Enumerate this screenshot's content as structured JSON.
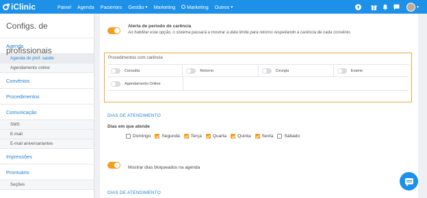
{
  "brand": {
    "name": "iClinic"
  },
  "nav": {
    "items": [
      {
        "label": "Painel"
      },
      {
        "label": "Agenda"
      },
      {
        "label": "Pacientes"
      },
      {
        "label": "Gestão",
        "dropdown": true
      },
      {
        "label": "Marketing"
      },
      {
        "label": "Marketing",
        "icon": "marketing-icon"
      },
      {
        "label": "Outros",
        "dropdown": true
      }
    ],
    "icons": [
      "add-circle-icon",
      "gift-icon",
      "bell-icon",
      "chat-icon",
      "avatar"
    ]
  },
  "sidebar": {
    "title": "Configs. de profissionais",
    "sections": [
      {
        "label": "Agenda",
        "items": [
          {
            "label": "Agenda do prof. saúde",
            "active": true
          },
          {
            "label": "Agendamento online"
          }
        ]
      },
      {
        "label": "Convênios",
        "items": []
      },
      {
        "label": "Procedimentos",
        "items": []
      },
      {
        "label": "Comunicação",
        "items": [
          {
            "label": "SMS"
          },
          {
            "label": "E-mail"
          },
          {
            "label": "E-mail aniversariantes"
          }
        ]
      },
      {
        "label": "Impressões",
        "items": []
      },
      {
        "label": "Prontuário",
        "items": [
          {
            "label": "Seções"
          }
        ]
      }
    ]
  },
  "main": {
    "alert": {
      "title": "Alerta de período de carência",
      "description": "Ao habilitar esta opção, o sistema passará a mostrar a data limite para retorno respeitando a carência de cada convênio.",
      "enabled": true
    },
    "procedures": {
      "title": "Procedimentos com carência",
      "items": [
        {
          "label": "Consulta",
          "enabled": false
        },
        {
          "label": "Retorno",
          "enabled": false
        },
        {
          "label": "Cirurgia",
          "enabled": false
        },
        {
          "label": "Exame",
          "enabled": false
        },
        {
          "label": "Agendamento Online",
          "enabled": false
        }
      ]
    },
    "days_heading": "DIAS DE ATENDIMENTO",
    "days_label": "Dias em que atende",
    "days": [
      {
        "label": "Domingo",
        "checked": false
      },
      {
        "label": "Segunda",
        "checked": true
      },
      {
        "label": "Terça",
        "checked": true
      },
      {
        "label": "Quarta",
        "checked": true
      },
      {
        "label": "Quinta",
        "checked": true
      },
      {
        "label": "Sexta",
        "checked": true
      },
      {
        "label": "Sábado",
        "checked": false
      }
    ],
    "blocked_days": {
      "label": "Mostrar dias bloqueados na agenda",
      "enabled": true
    },
    "days_heading_2": "DIAS DE ATENDIMENTO"
  },
  "colors": {
    "primary": "#1d90e8",
    "accent": "#f59d1f",
    "link": "#1d7fd0"
  }
}
